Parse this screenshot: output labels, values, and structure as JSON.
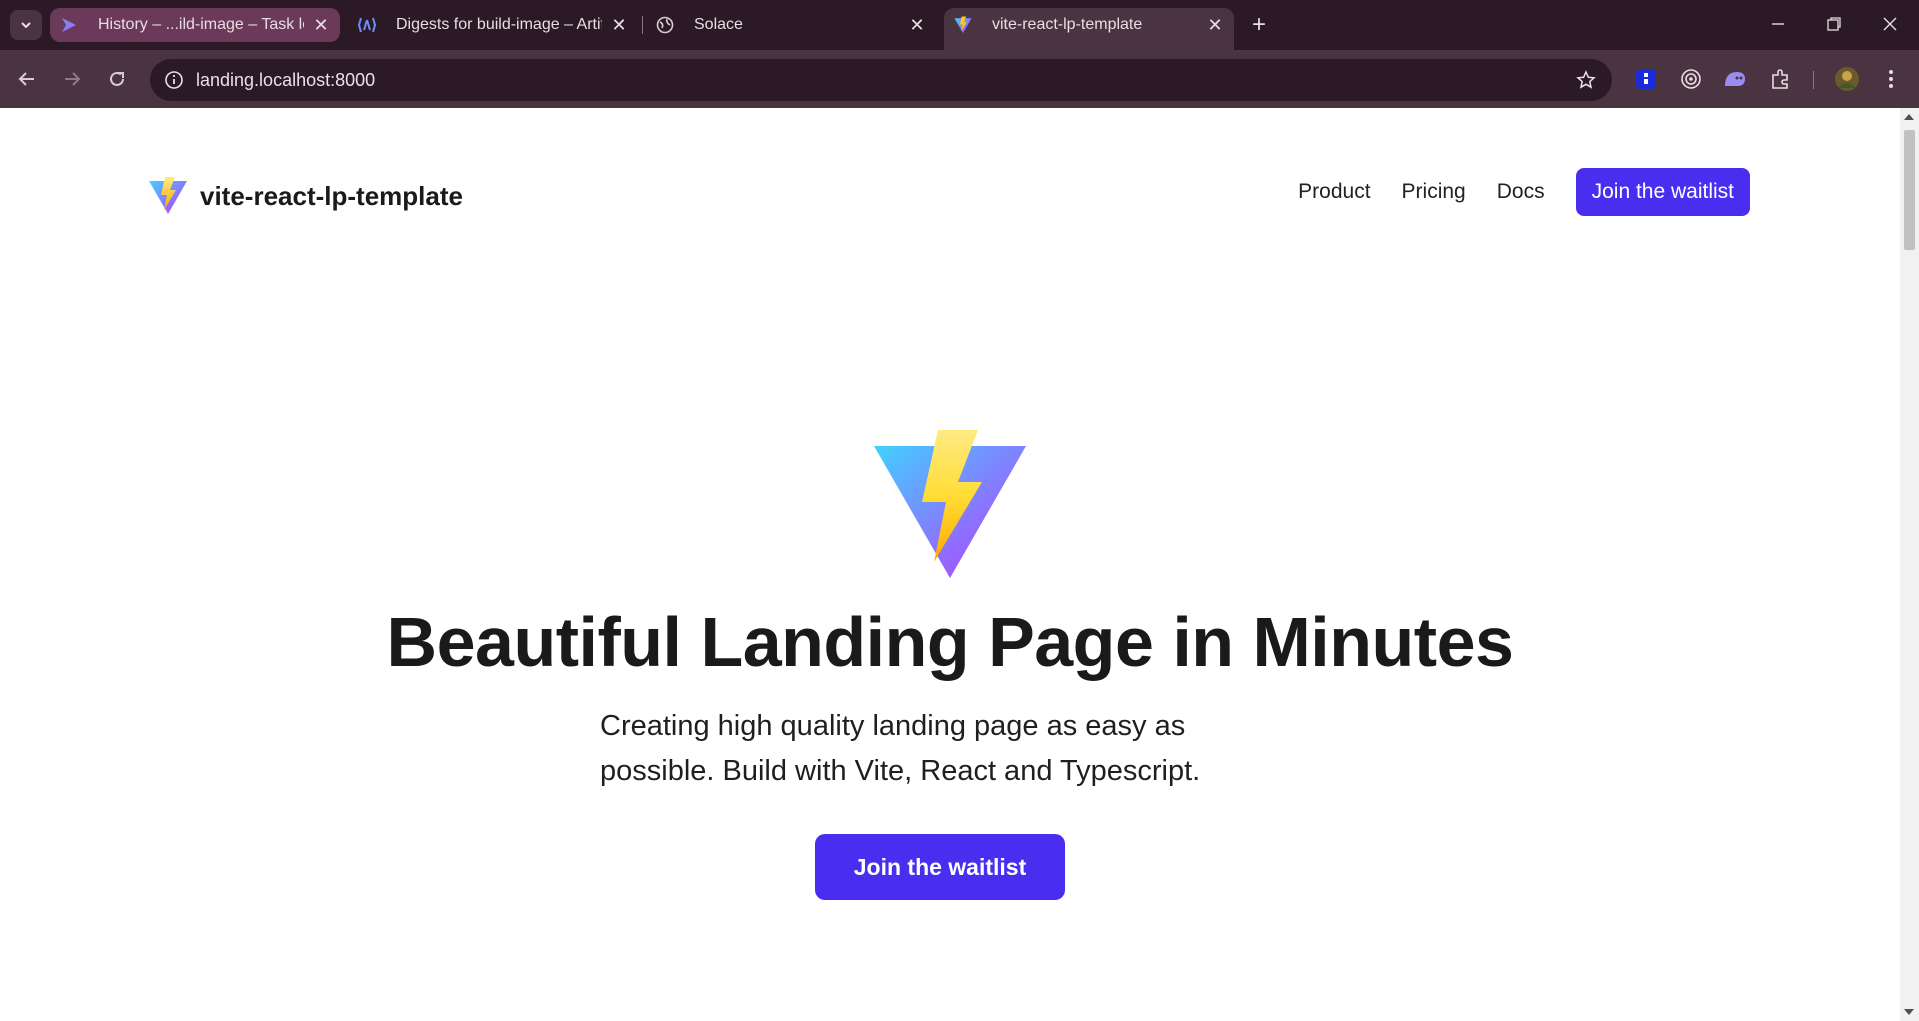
{
  "browser": {
    "tabs": [
      {
        "title": "History – ...ild-image – Task logs",
        "close": "✕"
      },
      {
        "title": "Digests for build-image – Artifacts",
        "close": "✕"
      },
      {
        "title": "Solace",
        "close": "✕"
      },
      {
        "title": "vite-react-lp-template",
        "close": "✕"
      }
    ],
    "new_tab": "+",
    "window_controls": {
      "minimize": "—",
      "restore": "❐",
      "close": "✕"
    },
    "address": "landing.localhost:8000"
  },
  "site": {
    "brand": "vite-react-lp-template",
    "nav": [
      "Product",
      "Pricing",
      "Docs"
    ],
    "nav_cta": "Join the waitlist",
    "hero": {
      "title": "Beautiful Landing Page in Minutes",
      "subtitle": "Creating high quality landing page as easy as possible. Build with Vite, React and Typescript.",
      "cta": "Join the waitlist"
    }
  },
  "colors": {
    "accent": "#4a2ef0",
    "tab_strip": "#2b1a25",
    "toolbar": "#4a3441",
    "active_pinned_tab": "#6b3a5a"
  },
  "icons": [
    "tab-search-icon",
    "azure-pipelines-icon",
    "azure-artifacts-icon",
    "globe-icon",
    "vite-logo-icon",
    "back-icon",
    "forward-icon",
    "reload-icon",
    "info-icon",
    "star-icon",
    "extension-icons",
    "puzzle-icon",
    "profile-avatar",
    "kebab-menu-icon"
  ]
}
